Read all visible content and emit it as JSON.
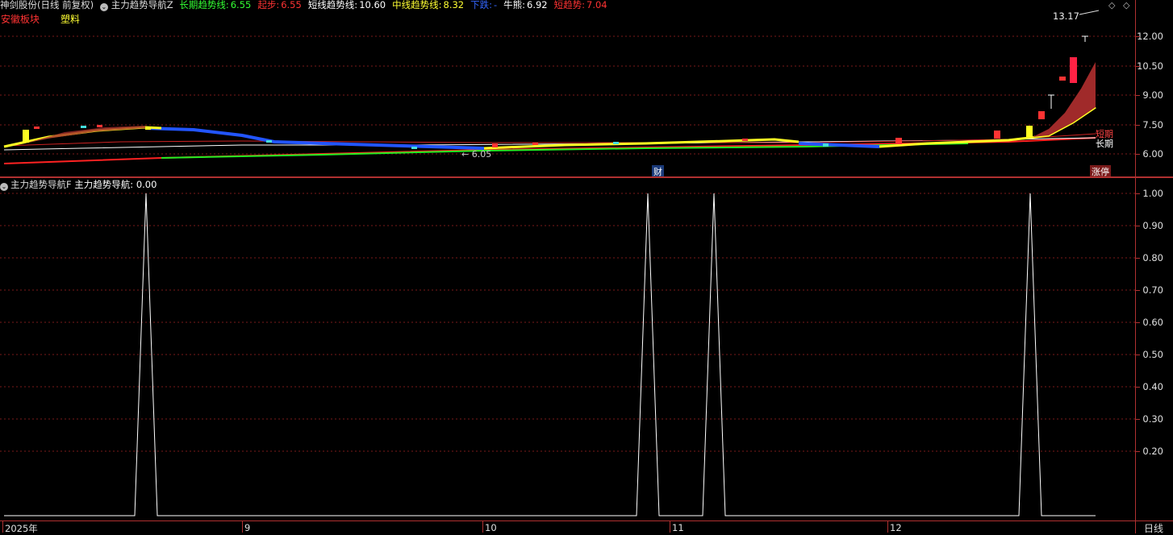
{
  "top_header": {
    "stock_name": "神剑股份(日线 前复权)",
    "indicator_name": "主力趋势导航Z",
    "items": [
      {
        "label": "长期趋势线:",
        "value": "6.55",
        "color": "#33ff33"
      },
      {
        "label": "起步:",
        "value": "6.55",
        "color": "#ff3333"
      },
      {
        "label": "短线趋势线:",
        "value": "10.60",
        "color": "#ffffff"
      },
      {
        "label": "中线趋势线:",
        "value": "8.32",
        "color": "#ffff33"
      },
      {
        "label": "下跌:",
        "value": "-",
        "color": "#3366ff"
      },
      {
        "label": "牛熊:",
        "value": "6.92",
        "color": "#ffffff"
      },
      {
        "label": "短趋势:",
        "value": "7.04",
        "color": "#ff3333"
      }
    ]
  },
  "tags": {
    "sector": "安徽板块",
    "industry": "塑料"
  },
  "price_labels": {
    "high_marker": "13.17",
    "low_marker": "6.05",
    "caiwu_marker": "财",
    "zhangting_marker": "涨停",
    "short_label": "短期",
    "long_label": "长期"
  },
  "upper_axis_ticks": [
    "12.00",
    "10.50",
    "9.00",
    "7.50",
    "6.00"
  ],
  "lower_header": {
    "indicator_name": "主力趋势导航F",
    "label": "主力趋势导航:",
    "value": "0.00"
  },
  "lower_axis_ticks": [
    "1.00",
    "0.90",
    "0.80",
    "0.70",
    "0.60",
    "0.50",
    "0.40",
    "0.30",
    "0.20"
  ],
  "x_labels": [
    "2025年",
    "9",
    "10",
    "11",
    "12"
  ],
  "period_label": "日线",
  "icons": {
    "collapse": "chevron-circle-icon",
    "diamond": "diamond-icon",
    "arrow": "arrow-icon"
  },
  "chart_data": {
    "type": "line",
    "title": "主力趋势导航F",
    "ylim": [
      0,
      1
    ],
    "signals": [
      {
        "index": 0,
        "value": 0
      },
      {
        "index": 1,
        "value": 1
      },
      {
        "index": 2,
        "value": 0
      },
      {
        "index": 3,
        "value": 1
      },
      {
        "index": 4,
        "value": 0
      },
      {
        "index": 5,
        "value": 1
      },
      {
        "index": 6,
        "value": 0
      },
      {
        "index": 7,
        "value": 1
      },
      {
        "index": 8,
        "value": 0
      }
    ]
  }
}
